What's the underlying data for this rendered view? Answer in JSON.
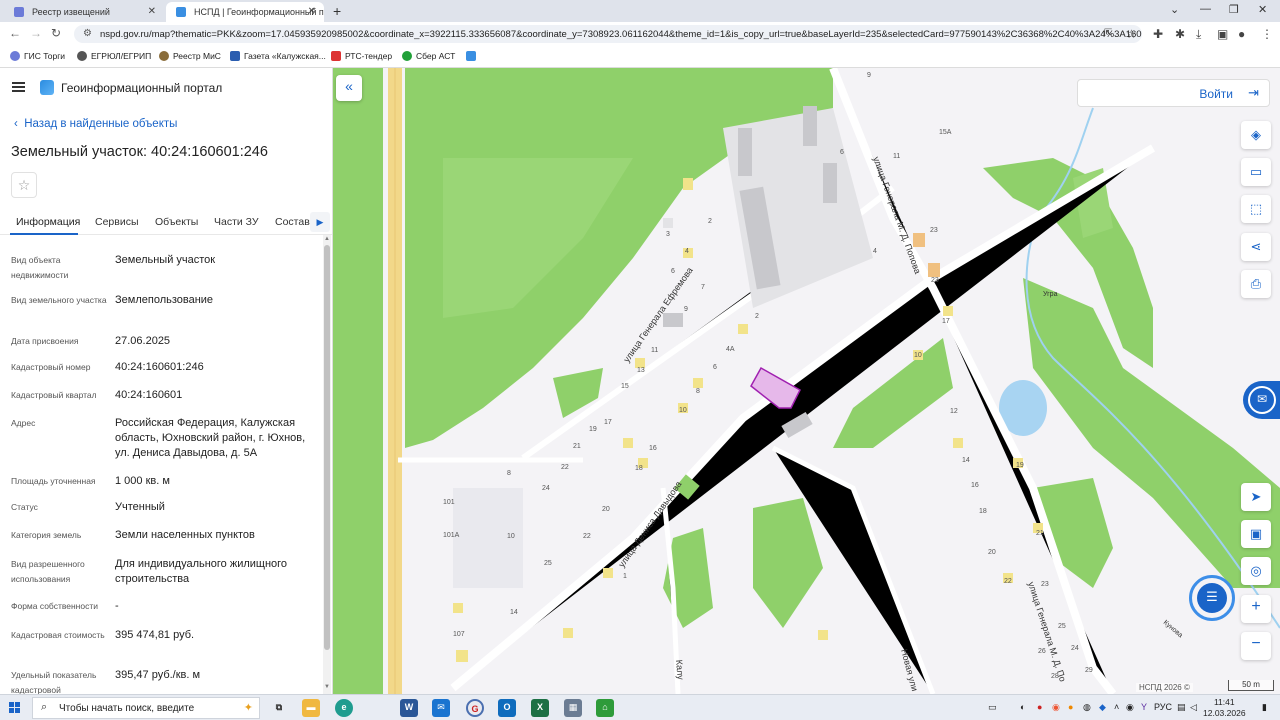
{
  "browser": {
    "tabs": [
      {
        "label": "Реестр извещений",
        "active": false
      },
      {
        "label": "НСПД | Геоинформационный п",
        "active": true
      }
    ],
    "url": "nspd.gov.ru/map?thematic=PKK&zoom=17.045935920985002&coordinate_x=3922115.333656087&coordinate_y=7308923.061162044&theme_id=1&is_copy_url=true&baseLayerId=235&selectedCard=977590143%2C36368%2C40%3A24%3A160601%3A246",
    "bookmarks": [
      "ГИС Торги",
      "ЕГРЮЛ/ЕГРИП",
      "Реестр МиС",
      "Газета «Калужская...",
      "РТС-тендер",
      "Сбер АСТ"
    ]
  },
  "panel": {
    "portal_title": "Геоинформационный портал",
    "back_link": "Назад в найденные объекты",
    "object_title": "Земельный участок: 40:24:160601:246",
    "tabs": [
      "Информация",
      "Сервисы",
      "Объекты",
      "Части ЗУ",
      "Состав"
    ],
    "properties": [
      {
        "label": "Вид объекта недвижимости",
        "value": "Земельный участок"
      },
      {
        "label": "Вид земельного участка",
        "value": "Землепользование"
      },
      {
        "label": "Дата присвоения",
        "value": "27.06.2025"
      },
      {
        "label": "Кадастровый номер",
        "value": "40:24:160601:246"
      },
      {
        "label": "Кадастровый квартал",
        "value": "40:24:160601"
      },
      {
        "label": "Адрес",
        "value": "Российская Федерация, Калужская область, Юхновский район, г. Юхнов, ул. Дениса Давыдова, д. 5А"
      },
      {
        "label": "Площадь уточненная",
        "value": "1 000 кв. м"
      },
      {
        "label": "Статус",
        "value": "Учтенный"
      },
      {
        "label": "Категория земель",
        "value": "Земли населенных пунктов"
      },
      {
        "label": "Вид разрешенного использования",
        "value": "Для индивидуального жилищного строительства"
      },
      {
        "label": "Форма собственности",
        "value": "-"
      },
      {
        "label": "Кадастровая стоимость",
        "value": "395 474,81 руб."
      },
      {
        "label": "Удельный показатель кадастровой",
        "value": "395,47 руб./кв. м"
      }
    ]
  },
  "map": {
    "login_label": "Войти",
    "copyright": "НСПД 2026 ©",
    "scale": "50 m",
    "streets": {
      "generala_efremova": "улица Генерала Ефремова",
      "denisa_davydova": "улица Дениса Давыдова",
      "generala_popova": "улица Генерала М. Д. Попова",
      "generala_popova_2": "улица Генерала М. Д. По",
      "novaya": "Новая ули",
      "kaluzhskaya": "Калу",
      "ugra": "Угра",
      "kunova": "Кунова"
    },
    "house_numbers": [
      "9",
      "15А",
      "11",
      "6",
      "2",
      "4",
      "6",
      "4",
      "2",
      "3",
      "7",
      "9",
      "11",
      "13",
      "15",
      "4А",
      "6",
      "8",
      "10",
      "19",
      "17",
      "21",
      "22",
      "16",
      "18",
      "24",
      "20",
      "22",
      "8",
      "101",
      "101А",
      "10",
      "25",
      "14",
      "107",
      "1",
      "23",
      "23",
      "17",
      "10",
      "12",
      "14",
      "16",
      "18",
      "20",
      "22",
      "19",
      "21",
      "23",
      "25",
      "24",
      "26",
      "28",
      "29"
    ]
  },
  "taskbar": {
    "search_placeholder": "Чтобы начать поиск, введите",
    "lang": "РУС",
    "time": "11:41",
    "date": "12.03.2026"
  }
}
